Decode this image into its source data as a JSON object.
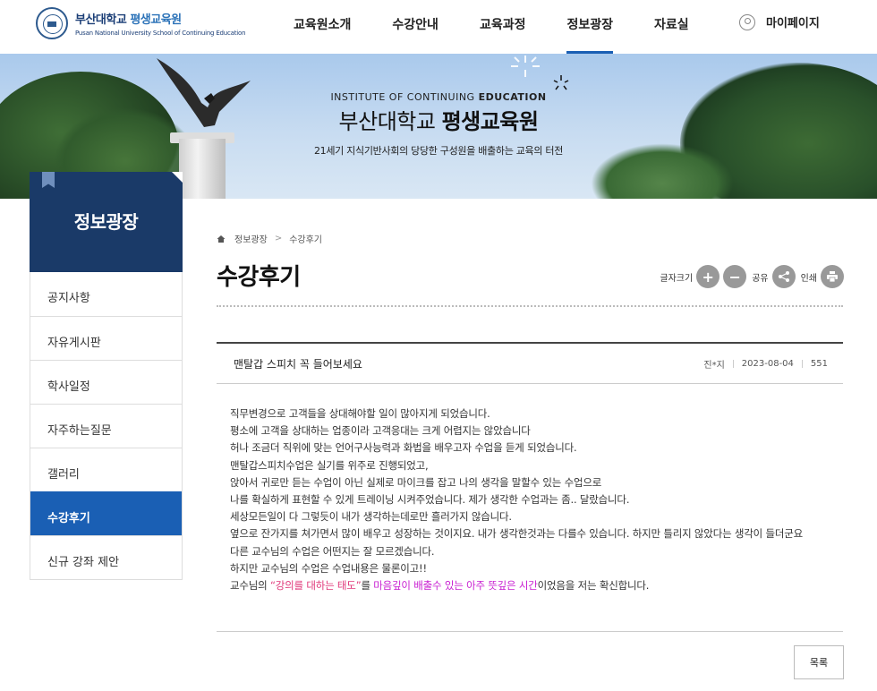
{
  "header": {
    "logo_title": "부산대학교",
    "logo_title_accent": "평생교육원",
    "logo_subtitle": "Pusan National University School of Continuing Education",
    "nav": [
      {
        "label": "교육원소개",
        "active": false
      },
      {
        "label": "수강안내",
        "active": false
      },
      {
        "label": "교육과정",
        "active": false
      },
      {
        "label": "정보광장",
        "active": true
      },
      {
        "label": "자료실",
        "active": false
      }
    ],
    "mypage_label": "마이페이지"
  },
  "banner": {
    "en_prefix": "INSTITUTE OF CONTINUING ",
    "en_bold": "EDUCATION",
    "ko_prefix": "부산대학교 ",
    "ko_bold": "평생교육원",
    "subtitle": "21세기 지식기반사회의 당당한 구성원을 배출하는 교육의 터전"
  },
  "sidebar": {
    "title": "정보광장",
    "items": [
      {
        "label": "공지사항",
        "active": false
      },
      {
        "label": "자유게시판",
        "active": false
      },
      {
        "label": "학사일정",
        "active": false
      },
      {
        "label": "자주하는질문",
        "active": false
      },
      {
        "label": "갤러리",
        "active": false
      },
      {
        "label": "수강후기",
        "active": true
      },
      {
        "label": "신규 강좌 제안",
        "active": false
      }
    ]
  },
  "breadcrumb": {
    "items": [
      "정보광장",
      "수강후기"
    ],
    "separator": ">"
  },
  "page": {
    "title": "수강후기"
  },
  "tools": {
    "font_size_label": "글자크기",
    "share_label": "공유",
    "print_label": "인쇄"
  },
  "post": {
    "title": "맨탈갑 스피치 꼭 들어보세요",
    "author": "진*지",
    "date": "2023-08-04",
    "views": "551",
    "lines": [
      "직무변경으로 고객들을 상대해야할 일이 많아지게 되었습니다.",
      "평소에 고객을 상대하는 업종이라 고객응대는 크게 어렵지는 않았습니다",
      "허나 조금더 직위에 맞는 언어구사능력과 화법을 배우고자 수업을 듣게 되었습니다.",
      "맨탈갑스피치수업은 실기를 위주로 진행되었고,",
      "앉아서 귀로만 듣는 수업이 아닌 실제로 마이크를 잡고 나의 생각을 말할수 있는 수업으로",
      "나를 확실하게 표현할 수 있게 트레이닝 시켜주었습니다. 제가 생각한 수업과는 좀.. 달랐습니다.",
      "세상모든일이 다 그렇듯이 내가 생각하는데로만 흘러가지 않습니다.",
      "옆으로 잔가지를 쳐가면서 많이 배우고 성장하는 것이지요. 내가 생각한것과는 다를수 있습니다. 하지만 틀리지 않았다는 생각이 들더군요",
      "다른 교수님의 수업은 어떤지는 잘 모르겠습니다.",
      "하지만 교수님의 수업은 수업내용은 물론이고!!"
    ],
    "last_line": {
      "part1": "교수님의 ",
      "highlight1": "“강의를 대하는 태도”",
      "part2": "를 ",
      "highlight2": "마음깊이 배출수 있는 아주 뜻깊은 시간",
      "part3": "이었음을 저는 확신합니다."
    },
    "highlight_colors": {
      "red": "#e0387a",
      "pink": "#c81ed1"
    }
  },
  "list_button_label": "목록",
  "colors": {
    "primary": "#1a5fb4",
    "sidebar_header": "#1a3a68",
    "logo_navy": "#1c3f77"
  }
}
